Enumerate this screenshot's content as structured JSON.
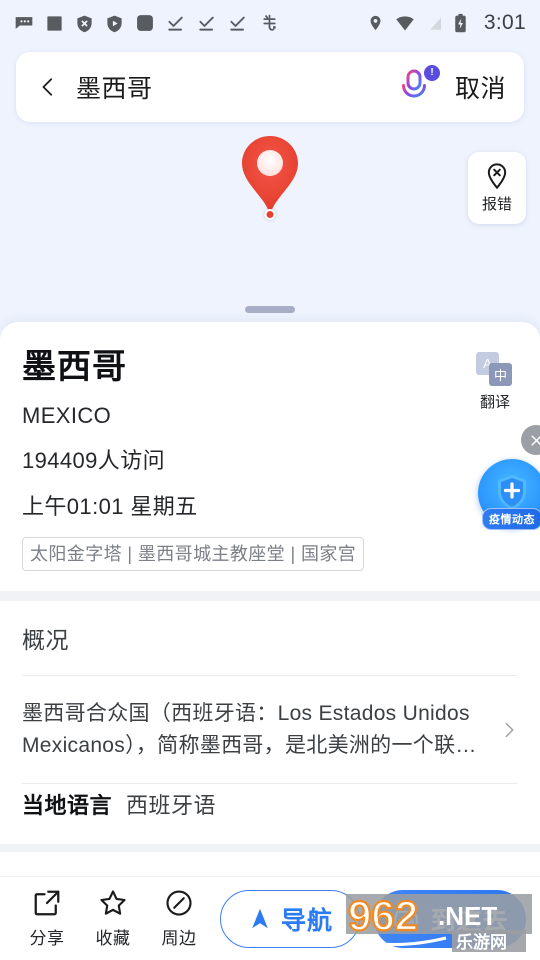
{
  "status_bar": {
    "time": "3:01",
    "left_icons": [
      "message-dots-icon",
      "square-icon",
      "shield-x-icon",
      "shield-play-icon",
      "rounded-square-icon",
      "check-underline-icon",
      "check-underline-icon",
      "check-underline-icon",
      "bug-icon"
    ],
    "right_icons": [
      "location-icon",
      "wifi-icon",
      "signal-off-icon",
      "battery-charging-icon"
    ]
  },
  "search": {
    "back_icon": "chevron-left-icon",
    "query": "墨西哥",
    "mic_icon": "microphone-icon",
    "mic_badge": "!",
    "cancel_label": "取消"
  },
  "map": {
    "pin_icon": "map-pin-marker",
    "report": {
      "icon": "pin-error-icon",
      "label": "报错"
    }
  },
  "poi": {
    "title": "墨西哥",
    "subtitle": "MEXICO",
    "visits": "194409人访问",
    "local_time": "上午01:01 星期五",
    "tags": "太阳金字塔 | 墨西哥城主教座堂 | 国家宫",
    "translate": {
      "icon_source": "A",
      "icon_target": "中",
      "label": "翻译"
    }
  },
  "epidemic_float": {
    "label": "疫情动态",
    "icon": "shield-plus-icon",
    "close_icon": "close-icon"
  },
  "overview": {
    "section_title": "概况",
    "description": "墨西哥合众国（西班牙语：Los Estados Unidos Mexicanos），简称墨西哥，是北美洲的一个联…",
    "chevron_icon": "chevron-right-icon"
  },
  "details": {
    "language_key": "当地语言",
    "language_value": "西班牙语"
  },
  "action_bar": {
    "items": [
      {
        "icon": "share-icon",
        "label": "分享"
      },
      {
        "icon": "star-icon",
        "label": "收藏"
      },
      {
        "icon": "compass-icon",
        "label": "周边"
      }
    ],
    "nav": {
      "icon": "navigation-arrow-icon",
      "label": "导航"
    },
    "go": {
      "icon": "car-icon",
      "label": "到这去"
    }
  },
  "watermark": {
    "number": "962",
    "domain": ".NET",
    "site": "乐游网"
  },
  "colors": {
    "accent_blue": "#2c76f0",
    "pin_red": "#e8402e",
    "map_bg": "#eef3fd",
    "epidemic_blue": "#2f9bff"
  }
}
